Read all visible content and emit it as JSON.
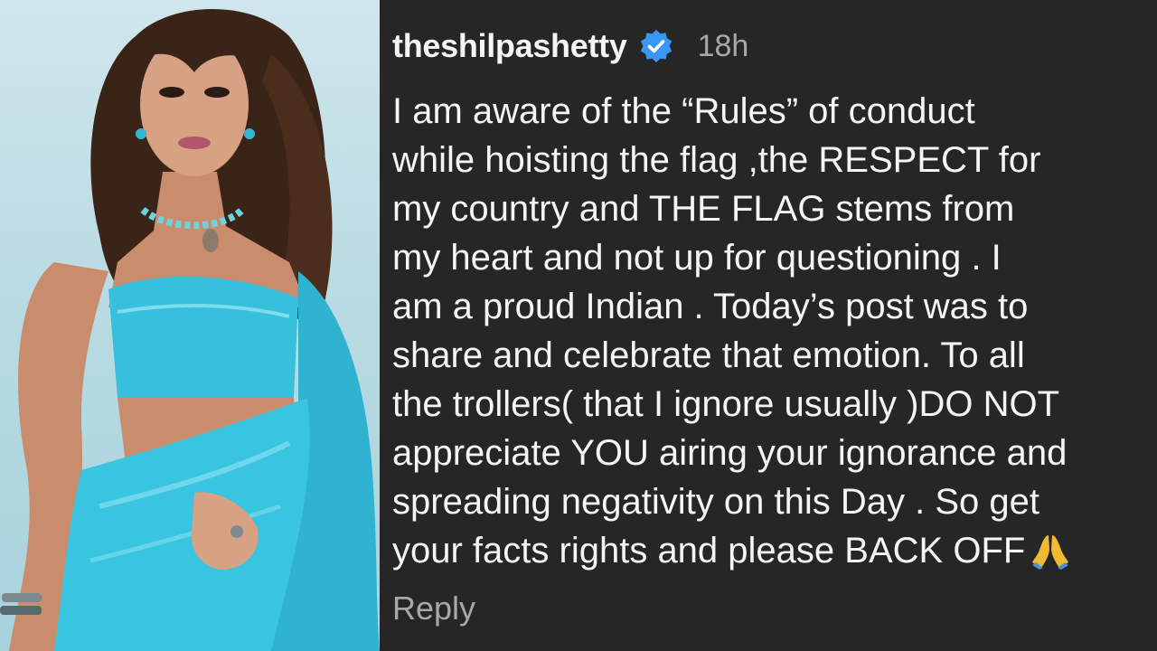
{
  "comment": {
    "username": "theshilpashetty",
    "verified_icon": "verified-badge-icon",
    "timestamp": "18h",
    "lines": [
      "I am aware of the “Rules”  of conduct",
      "while hoisting the flag ,the RESPECT for",
      "my country and THE FLAG stems from",
      "my heart and not up for questioning . I",
      "am a proud Indian . Today’s post was to",
      "share and celebrate that emotion. To all",
      "the trollers( that I ignore usually )DO NOT",
      "appreciate YOU airing your ignorance and",
      "spreading negativity on this Day . So get",
      "your facts rights and  please BACK OFF"
    ],
    "emoji_icon": "folded-hands-icon",
    "reply_label": "Reply"
  },
  "colors": {
    "background": "#262626",
    "text": "#f5f5f5",
    "muted": "#a8a8a8",
    "verified": "#3897f0",
    "saree": "#36c0dc"
  }
}
